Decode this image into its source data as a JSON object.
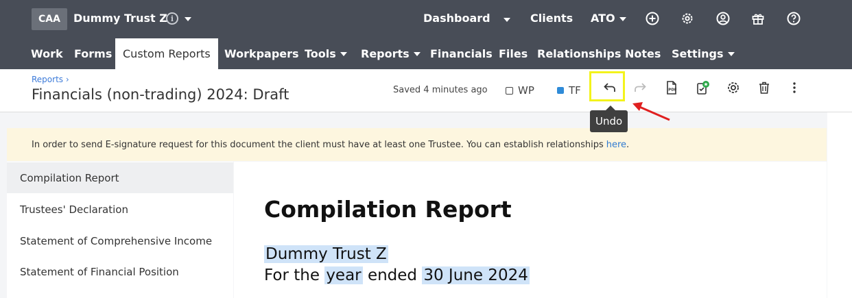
{
  "header": {
    "badge": "CAA",
    "client_name": "Dummy Trust Z",
    "info_icon_glyph": "i",
    "top_nav": {
      "dashboard": "Dashboard",
      "clients": "Clients",
      "ato": "ATO"
    },
    "icons": [
      "plus-circle-icon",
      "gear-icon",
      "user-circle-icon",
      "gift-icon",
      "help-circle-icon"
    ]
  },
  "nav": {
    "work": "Work",
    "forms": "Forms",
    "custom_reports": "Custom Reports",
    "workpapers": "Workpapers",
    "tools": "Tools",
    "reports": "Reports",
    "financials": "Financials",
    "files": "Files",
    "relationships": "Relationships",
    "notes": "Notes",
    "settings": "Settings"
  },
  "subheader": {
    "breadcrumb": "Reports ›",
    "title": "Financials (non-trading) 2024: Draft",
    "saved": "Saved 4 minutes ago",
    "wp_label": "WP",
    "tf_label": "TF",
    "tooltip": "Undo",
    "colors": {
      "highlight": "#f3f31c",
      "tf_checkbox": "#2f8bd8",
      "arrow": "#e02020"
    }
  },
  "banner": {
    "text": "In order to send E-signature request for this document the client must have at least one Trustee. You can establish relationships",
    "link": "here",
    "end": "."
  },
  "sidebar": {
    "items": [
      "Compilation Report",
      "Trustees' Declaration",
      "Statement of Comprehensive Income",
      "Statement of Financial Position"
    ]
  },
  "document": {
    "title": "Compilation Report",
    "entity": "Dummy Trust Z",
    "for_the": "For the",
    "year": "year",
    "ended": "ended",
    "date": "30 June 2024"
  }
}
